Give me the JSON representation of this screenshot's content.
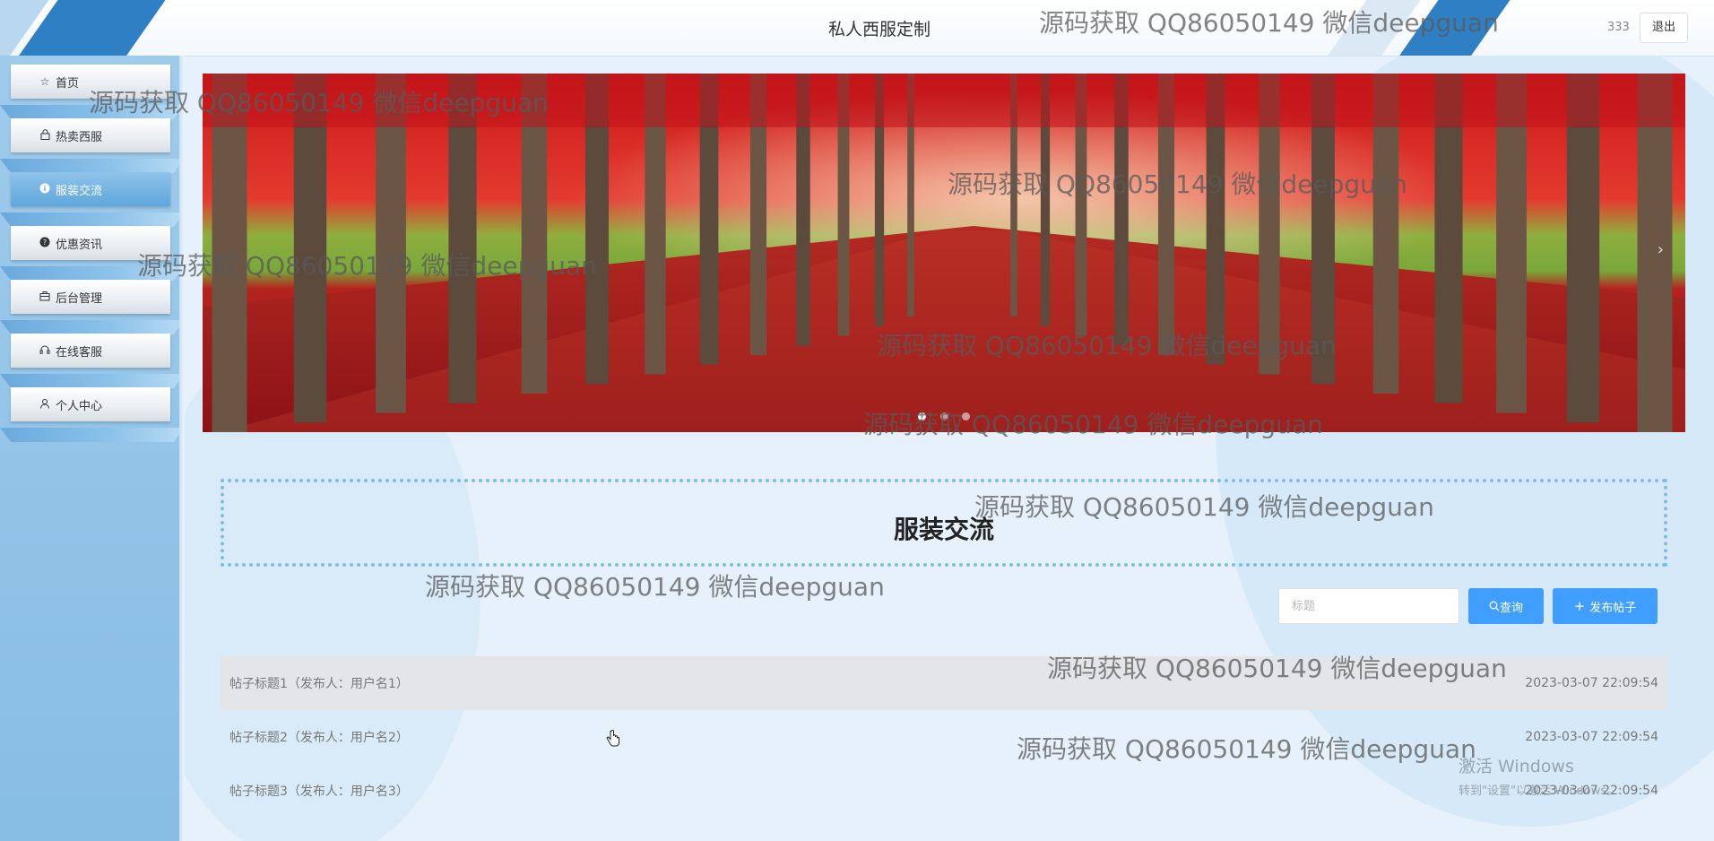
{
  "header": {
    "title": "私人西服定制",
    "username": "333",
    "logout_label": "退出"
  },
  "sidebar": {
    "items": [
      {
        "label": "首页",
        "icon": "star-icon"
      },
      {
        "label": "热卖西服",
        "icon": "lock-icon"
      },
      {
        "label": "服装交流",
        "icon": "info-icon",
        "active": true
      },
      {
        "label": "优惠资讯",
        "icon": "question-icon"
      },
      {
        "label": "后台管理",
        "icon": "briefcase-icon"
      },
      {
        "label": "在线客服",
        "icon": "headset-icon"
      },
      {
        "label": "个人中心",
        "icon": "user-icon"
      }
    ]
  },
  "banner": {
    "slide_count": 3,
    "active_index": 0,
    "next_icon": "chevron-right-icon"
  },
  "section": {
    "title": "服装交流"
  },
  "search": {
    "placeholder": "标题",
    "search_label": "查询",
    "publish_label": "发布帖子"
  },
  "posts": [
    {
      "title": "帖子标题1（发布人：用户名1）",
      "date": "2023-03-07 22:09:54"
    },
    {
      "title": "帖子标题2（发布人：用户名2）",
      "date": "2023-03-07 22:09:54"
    },
    {
      "title": "帖子标题3（发布人：用户名3）",
      "date": "2023-03-07 22:09:54"
    }
  ],
  "watermark": "源码获取 QQ86050149 微信deepguan",
  "os_notice": {
    "line1": "激活 Windows",
    "line2": "转到\"设置\"以激活 Windows。"
  },
  "colors": {
    "accent": "#409eff",
    "sidebar": "#9fcbeb",
    "active_nav": "#5ea7dc",
    "dotted_border": "#7fbde6"
  }
}
